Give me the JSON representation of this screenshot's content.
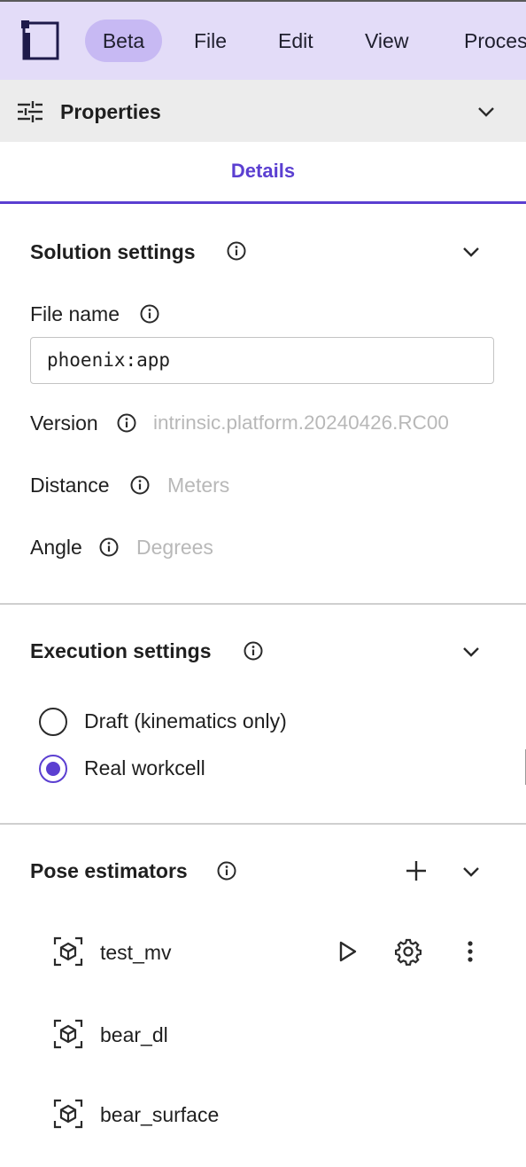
{
  "menubar": {
    "logo": "app-logo-icon",
    "items": [
      "Beta",
      "File",
      "Edit",
      "View",
      "Process"
    ],
    "active": "Beta"
  },
  "properties_panel": {
    "title": "Properties",
    "icon": "tune-sliders-icon",
    "tabs": [
      "Details"
    ]
  },
  "solution_settings": {
    "title": "Solution settings",
    "file_name": {
      "label": "File name",
      "value": "phoenix:app"
    },
    "version": {
      "label": "Version",
      "value": "intrinsic.platform.20240426.RC00"
    },
    "distance": {
      "label": "Distance",
      "value": "Meters"
    },
    "angle": {
      "label": "Angle",
      "value": "Degrees"
    }
  },
  "execution_settings": {
    "title": "Execution settings",
    "options": [
      {
        "label": "Draft (kinematics only)",
        "selected": false
      },
      {
        "label": "Real workcell",
        "selected": true
      }
    ]
  },
  "pose_estimators": {
    "title": "Pose estimators",
    "items": [
      {
        "name": "test_mv"
      },
      {
        "name": "bear_dl"
      },
      {
        "name": "bear_surface"
      }
    ]
  },
  "colors": {
    "accent": "#5b3fd1",
    "menubar_bg": "#e3dcf8",
    "active_menu_bg": "#c7b9f3",
    "properties_bar_bg": "#ececec",
    "placeholder_text": "#b8b8b8"
  }
}
